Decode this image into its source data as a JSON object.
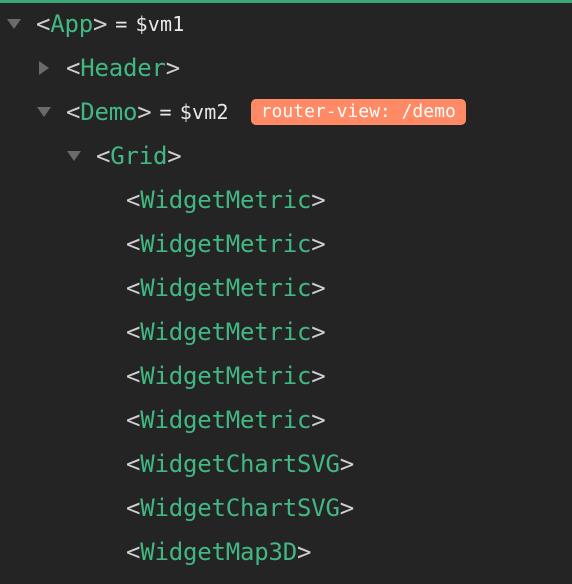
{
  "tree": {
    "app": {
      "open": "<",
      "name": "App",
      "close": ">",
      "assign_equals": "=",
      "assign_var": "$vm1"
    },
    "header": {
      "open": "<",
      "name": "Header",
      "close": ">"
    },
    "demo": {
      "open": "<",
      "name": "Demo",
      "close": ">",
      "assign_equals": "=",
      "assign_var": "$vm2",
      "badge": "router-view: /demo"
    },
    "grid": {
      "open": "<",
      "name": "Grid",
      "close": ">"
    },
    "widgets": [
      {
        "open": "<",
        "name": "WidgetMetric",
        "close": ">"
      },
      {
        "open": "<",
        "name": "WidgetMetric",
        "close": ">"
      },
      {
        "open": "<",
        "name": "WidgetMetric",
        "close": ">"
      },
      {
        "open": "<",
        "name": "WidgetMetric",
        "close": ">"
      },
      {
        "open": "<",
        "name": "WidgetMetric",
        "close": ">"
      },
      {
        "open": "<",
        "name": "WidgetMetric",
        "close": ">"
      },
      {
        "open": "<",
        "name": "WidgetChartSVG",
        "close": ">"
      },
      {
        "open": "<",
        "name": "WidgetChartSVG",
        "close": ">"
      },
      {
        "open": "<",
        "name": "WidgetMap3D",
        "close": ">"
      }
    ]
  },
  "theme": {
    "background": "#242424",
    "accent_bar": "#3aa776",
    "component_name": "#41b883",
    "badge_bg": "#ff8a65",
    "toggle_icon": "#6a6a6a"
  },
  "icons": {
    "expanded": "triangle-down",
    "collapsed": "triangle-right"
  }
}
